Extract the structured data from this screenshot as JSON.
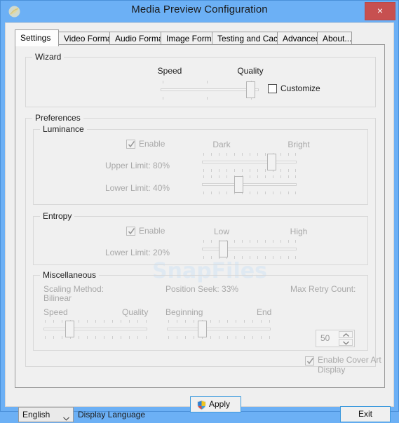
{
  "window": {
    "title": "Media Preview Configuration",
    "icon": "app-icon",
    "close_label": "×",
    "titlebar_color": "#6cb0f5",
    "close_color": "#c75050"
  },
  "tabs": [
    {
      "label": "Settings",
      "active": true
    },
    {
      "label": "Video Formats",
      "active": false
    },
    {
      "label": "Audio Formats",
      "active": false
    },
    {
      "label": "Image Formats",
      "active": false
    },
    {
      "label": "Testing and Cache",
      "active": false
    },
    {
      "label": "Advanced",
      "active": false
    },
    {
      "label": "About...",
      "active": false
    }
  ],
  "wizard": {
    "group_label": "Wizard",
    "left_label": "Speed",
    "right_label": "Quality",
    "slider_value_pct": 91,
    "customize": {
      "label": "Customize",
      "checked": false,
      "enabled": true
    }
  },
  "preferences": {
    "group_label": "Preferences",
    "luminance": {
      "group_label": "Luminance",
      "enable": {
        "label": "Enable",
        "checked": true,
        "enabled": false
      },
      "left_label": "Dark",
      "right_label": "Bright",
      "upper": {
        "label": "Upper Limit: 80%",
        "value_pct": 80
      },
      "lower": {
        "label": "Lower Limit: 40%",
        "value_pct": 40
      }
    },
    "entropy": {
      "group_label": "Entropy",
      "enable": {
        "label": "Enable",
        "checked": true,
        "enabled": false
      },
      "left_label": "Low",
      "right_label": "High",
      "lower": {
        "label": "Lower Limit: 20%",
        "value_pct": 20
      }
    },
    "miscellaneous": {
      "group_label": "Miscellaneous",
      "scaling_label": "Scaling Method:",
      "scaling_value": "Bilinear",
      "scaling_left": "Speed",
      "scaling_right": "Quality",
      "scaling_value_pct": 25,
      "position_label": "Position Seek: 33%",
      "position_left": "Beginning",
      "position_right": "End",
      "position_value_pct": 33,
      "max_retry_label": "Max Retry Count:",
      "max_retry_value": "50",
      "cover_art": {
        "label": "Enable Cover Art Display",
        "checked": true,
        "enabled": false
      }
    }
  },
  "apply": {
    "label": "Apply",
    "icon": "uac-shield-icon"
  },
  "footer": {
    "language_value": "English",
    "language_caption": "Display Language",
    "exit_label": "Exit"
  },
  "watermark": {
    "text": "SnapFiles"
  }
}
